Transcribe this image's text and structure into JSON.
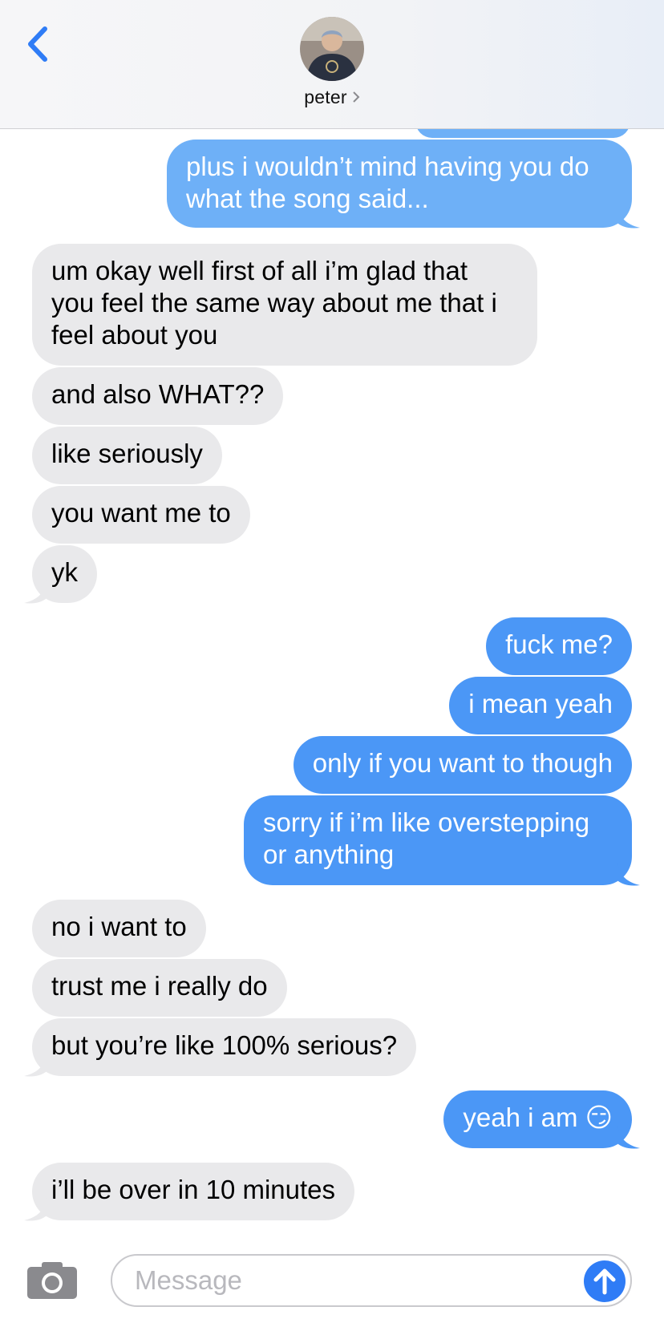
{
  "header": {
    "contact_name": "peter",
    "back_icon": "chevron-left-icon",
    "name_chevron": "›"
  },
  "colors": {
    "outgoing_bubble": "#4b97f6",
    "incoming_bubble": "#e9e9eb",
    "accent": "#2f7cf6"
  },
  "messages": [
    {
      "direction": "out",
      "text_lines": [
        "plus i wouldn’t mind having you do",
        "what the song said..."
      ]
    },
    {
      "direction": "in",
      "text_lines": [
        "um okay well first of all i’m glad that",
        "you feel the same way about me that i",
        "feel about you"
      ]
    },
    {
      "direction": "in",
      "text_lines": [
        "and also WHAT??"
      ]
    },
    {
      "direction": "in",
      "text_lines": [
        "like seriously"
      ]
    },
    {
      "direction": "in",
      "text_lines": [
        "you want me to"
      ]
    },
    {
      "direction": "in",
      "text_lines": [
        "yk"
      ]
    },
    {
      "direction": "out",
      "text_lines": [
        "fuck me?"
      ]
    },
    {
      "direction": "out",
      "text_lines": [
        "i mean yeah"
      ]
    },
    {
      "direction": "out",
      "text_lines": [
        "only if you want to though"
      ]
    },
    {
      "direction": "out",
      "text_lines": [
        "sorry if i’m like overstepping",
        "or anything"
      ]
    },
    {
      "direction": "in",
      "text_lines": [
        "no i want to"
      ]
    },
    {
      "direction": "in",
      "text_lines": [
        "trust me i really do"
      ]
    },
    {
      "direction": "in",
      "text_lines": [
        "but you’re like 100% serious?"
      ]
    },
    {
      "direction": "out",
      "text_lines": [
        "yeah i am 😏"
      ]
    },
    {
      "direction": "in",
      "text_lines": [
        "i’ll be over in 10 minutes"
      ]
    }
  ],
  "composer": {
    "placeholder": "Message",
    "camera_icon": "camera-icon",
    "send_icon": "arrow-up-icon"
  }
}
